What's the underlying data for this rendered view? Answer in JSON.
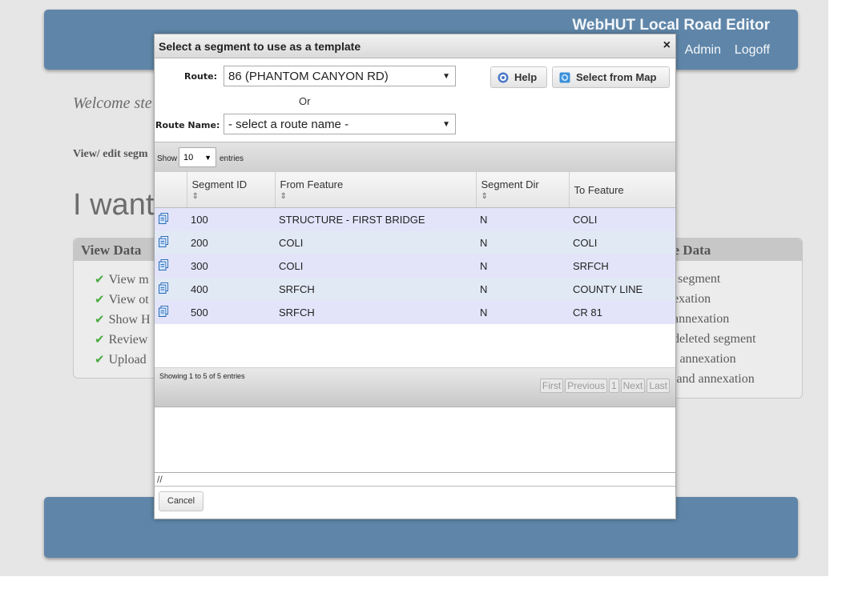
{
  "app": {
    "title": "WebHUT Local Road Editor",
    "admin_label": "Admin",
    "logoff_label": "Logoff"
  },
  "page": {
    "welcome_text": "Welcome ste",
    "view_edit_text": "View/ edit segm",
    "i_want_text": "I want"
  },
  "left_panel": {
    "title": "View Data",
    "items": [
      "View m",
      "View ot",
      "Show H",
      "Review",
      "Upload"
    ]
  },
  "right_panel": {
    "title": "ve Data",
    "items": [
      "segment",
      "exation",
      "annexation",
      "deleted segment",
      "l annexation",
      "land annexation"
    ]
  },
  "dialog": {
    "title": "Select a segment to use as a template",
    "close_icon": "×",
    "route_label": "Route:",
    "route_value": "86 (PHANTOM CANYON RD)",
    "or_label": "Or",
    "route_name_label": "Route Name:",
    "route_name_value": "- select a route name -",
    "help_label": "Help",
    "select_from_map_label": "Select from Map",
    "cancel_label": "Cancel",
    "resize_glyph": "//"
  },
  "table": {
    "show_label": "Show",
    "entries_label": "entries",
    "page_length": "10",
    "columns": [
      "",
      "Segment ID",
      "From Feature",
      "Segment Dir",
      "To Feature"
    ],
    "rows": [
      {
        "segment_id": "100",
        "from_feature": "STRUCTURE - FIRST BRIDGE",
        "segment_dir": "N",
        "to_feature": "COLI"
      },
      {
        "segment_id": "200",
        "from_feature": "COLI",
        "segment_dir": "N",
        "to_feature": "COLI"
      },
      {
        "segment_id": "300",
        "from_feature": "COLI",
        "segment_dir": "N",
        "to_feature": "SRFCH"
      },
      {
        "segment_id": "400",
        "from_feature": "SRFCH",
        "segment_dir": "N",
        "to_feature": "COUNTY LINE"
      },
      {
        "segment_id": "500",
        "from_feature": "SRFCH",
        "segment_dir": "N",
        "to_feature": "CR 81"
      }
    ],
    "info": "Showing 1 to 5 of 5 entries",
    "pagination": {
      "first": "First",
      "previous": "Previous",
      "page": "1",
      "next": "Next",
      "last": "Last"
    }
  },
  "icons": {
    "copy_row": "copy-icon",
    "help": "help-icon",
    "map": "map-icon",
    "check": "check-icon"
  },
  "colors": {
    "header_bg": "#5f86a9",
    "row_odd": "#e3e4fa",
    "row_even": "#e1e9f5",
    "check_green": "#4caa42"
  }
}
